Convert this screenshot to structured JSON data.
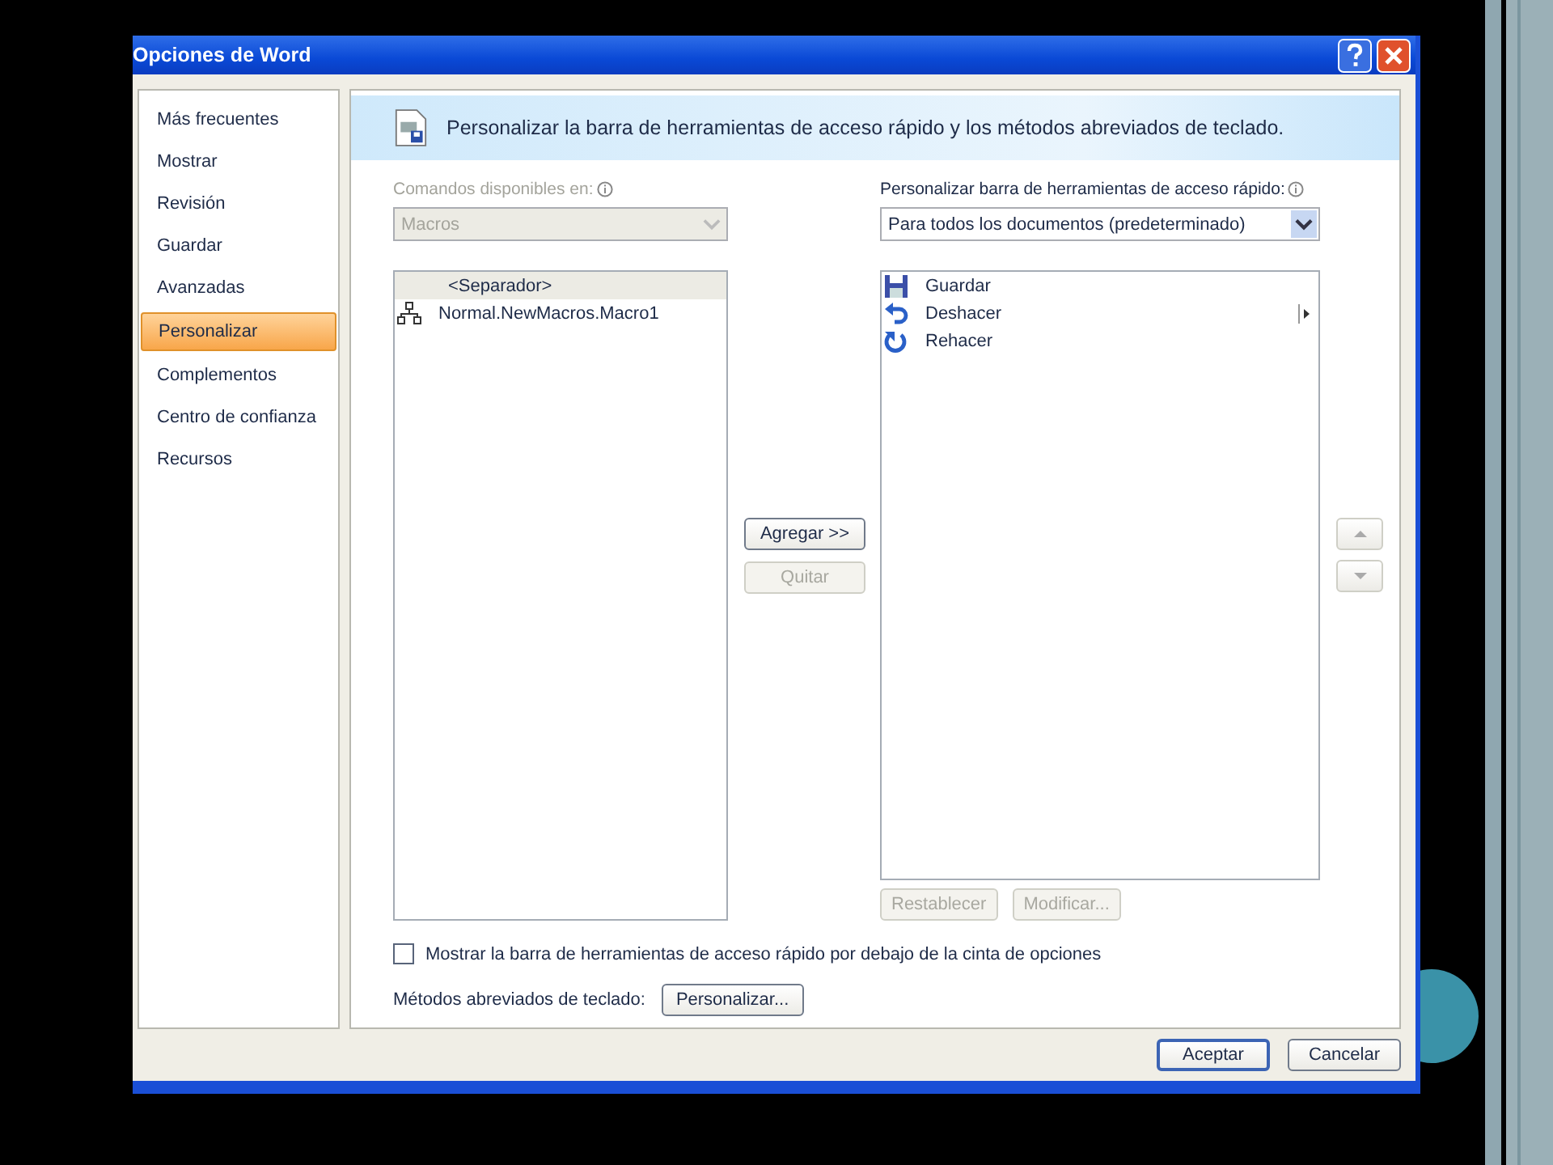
{
  "window": {
    "title": "Opciones de Word"
  },
  "sidebar": {
    "items": [
      {
        "label": "Más frecuentes",
        "selected": false
      },
      {
        "label": "Mostrar",
        "selected": false
      },
      {
        "label": "Revisión",
        "selected": false
      },
      {
        "label": "Guardar",
        "selected": false
      },
      {
        "label": "Avanzadas",
        "selected": false
      },
      {
        "label": "Personalizar",
        "selected": true
      },
      {
        "label": "Complementos",
        "selected": false
      },
      {
        "label": "Centro de confianza",
        "selected": false
      },
      {
        "label": "Recursos",
        "selected": false
      }
    ]
  },
  "header": {
    "title": "Personalizar la barra de herramientas de acceso rápido y los métodos abreviados de teclado."
  },
  "commands": {
    "label": "Comandos disponibles en:",
    "dropdown": {
      "value": "Macros",
      "disabled": true
    },
    "items": [
      {
        "label": "<Separador>",
        "kind": "separator",
        "selected": true
      },
      {
        "label": "Normal.NewMacros.Macro1",
        "kind": "macro",
        "selected": false
      }
    ]
  },
  "move_buttons": [
    {
      "label": "Agregar >>",
      "disabled": false
    },
    {
      "label": "Quitar",
      "disabled": true
    }
  ],
  "toolbar": {
    "label": "Personalizar barra de herramientas de acceso rápido:",
    "dropdown": {
      "value": "Para todos los documentos (predeterminado)",
      "disabled": false
    },
    "items": [
      {
        "label": "Guardar",
        "kind": "save",
        "submenu": false
      },
      {
        "label": "Deshacer",
        "kind": "undo",
        "submenu": true
      },
      {
        "label": "Rehacer",
        "kind": "redo",
        "submenu": false
      }
    ],
    "buttons": [
      {
        "label": "Restablecer",
        "disabled": true
      },
      {
        "label": "Modificar...",
        "disabled": true
      }
    ]
  },
  "show_below": {
    "label": "Mostrar la barra de herramientas de acceso rápido por debajo de la cinta de opciones",
    "checked": false
  },
  "shortcuts": {
    "label": "Métodos abreviados de teclado:",
    "button": "Personalizar..."
  },
  "footer_buttons": [
    {
      "label": "Aceptar",
      "default": true
    },
    {
      "label": "Cancelar",
      "default": false
    }
  ]
}
